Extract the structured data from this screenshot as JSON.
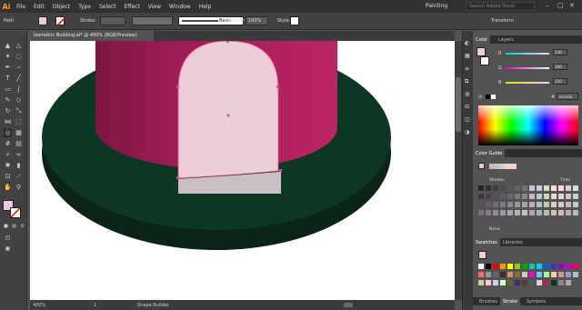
{
  "app": {
    "logo": "Ai",
    "workspace": "Painting",
    "search_placeholder": "Search Adobe Stock"
  },
  "menu": [
    "File",
    "Edit",
    "Object",
    "Type",
    "Select",
    "Effect",
    "View",
    "Window",
    "Help"
  ],
  "control": {
    "selection": "Path",
    "stroke_label": "Stroke:",
    "stroke_value": "",
    "brush": "Basic",
    "opacity_label": "Opacity:",
    "opacity_value": "100%",
    "style_label": "Style:",
    "transform_label": "Transform"
  },
  "document": {
    "tab_title": "Isometric Building.ai* @ 400% (RGB/Preview)"
  },
  "status": {
    "zoom": "400%",
    "page": "1",
    "tool": "Shape Builder"
  },
  "color_panel": {
    "tabs": [
      "Color",
      "Layers"
    ],
    "r": "236",
    "g": "206",
    "b": "220",
    "hex": "ecceda",
    "none": "None"
  },
  "color_guide": {
    "title": "Color Guide",
    "shades": "Shades",
    "tints": "Tints",
    "harmony": "None"
  },
  "swatches": {
    "tabs": [
      "Swatches",
      "Libraries"
    ]
  },
  "bottom_tabs": [
    "Brushes",
    "Stroke",
    "Symbols"
  ],
  "colors": {
    "fill": "#ecceda",
    "magenta": "#b52061",
    "platform": "#0b3822",
    "accent": "#ff9a00"
  }
}
